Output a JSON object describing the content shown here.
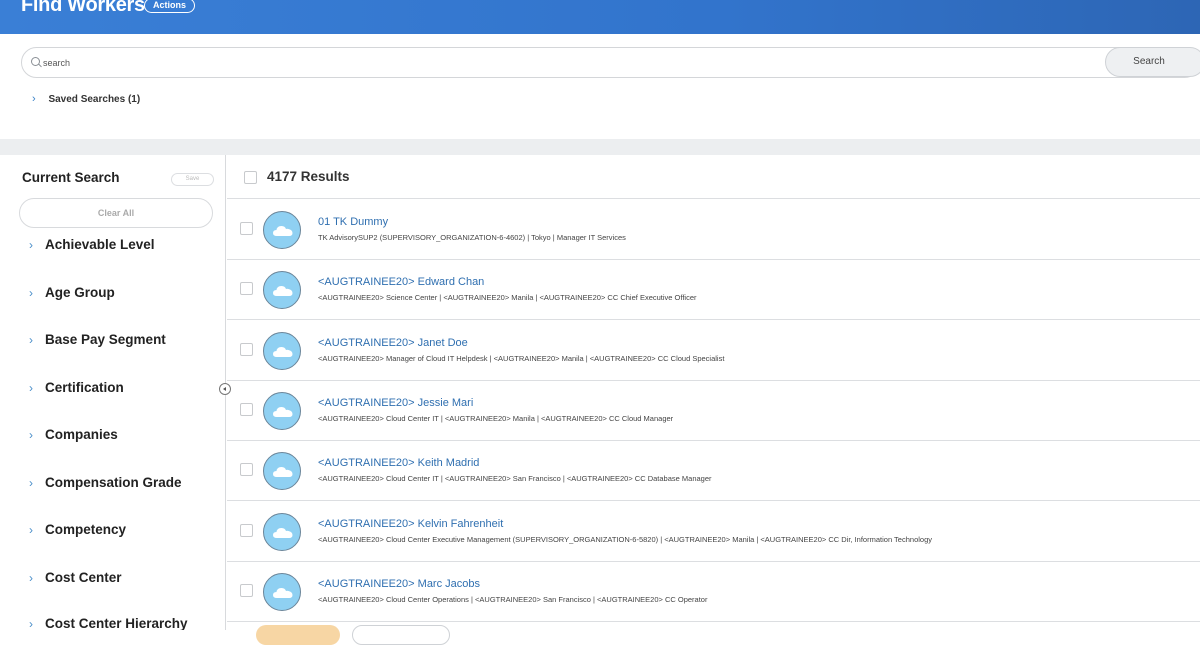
{
  "header": {
    "title": "Find Workers",
    "actions_label": "Actions",
    "bg_color": "#3274cc"
  },
  "search": {
    "placeholder": "search",
    "value": "",
    "button_label": "Search",
    "saved_searches_label": "Saved Searches (1)"
  },
  "sidebar": {
    "title": "Current Search",
    "save_label": "Save",
    "clear_all_label": "Clear All",
    "facets": [
      {
        "label": "Achievable Level"
      },
      {
        "label": "Age Group"
      },
      {
        "label": "Base Pay Segment"
      },
      {
        "label": "Certification"
      },
      {
        "label": "Companies"
      },
      {
        "label": "Compensation Grade"
      },
      {
        "label": "Competency"
      },
      {
        "label": "Cost Center"
      },
      {
        "label": "Cost Center Hierarchy"
      }
    ]
  },
  "results": {
    "count_label": "4177 Results",
    "items": [
      {
        "name": "01 TK Dummy",
        "detail": "TK AdvisorySUP2 (SUPERVISORY_ORGANIZATION-6-4602) | Tokyo | Manager IT Services"
      },
      {
        "name": "<AUGTRAINEE20> Edward Chan",
        "detail": "<AUGTRAINEE20> Science Center | <AUGTRAINEE20> Manila | <AUGTRAINEE20> CC Chief Executive Officer"
      },
      {
        "name": "<AUGTRAINEE20> Janet Doe",
        "detail": "<AUGTRAINEE20> Manager of Cloud IT Helpdesk | <AUGTRAINEE20> Manila | <AUGTRAINEE20> CC Cloud Specialist"
      },
      {
        "name": "<AUGTRAINEE20> Jessie Mari",
        "detail": "<AUGTRAINEE20> Cloud Center IT | <AUGTRAINEE20> Manila | <AUGTRAINEE20> CC Cloud Manager"
      },
      {
        "name": "<AUGTRAINEE20> Keith Madrid",
        "detail": "<AUGTRAINEE20> Cloud Center IT | <AUGTRAINEE20> San Francisco | <AUGTRAINEE20> CC Database Manager"
      },
      {
        "name": "<AUGTRAINEE20> Kelvin Fahrenheit",
        "detail": "<AUGTRAINEE20> Cloud Center Executive Management (SUPERVISORY_ORGANIZATION-6-5820) | <AUGTRAINEE20> Manila | <AUGTRAINEE20> CC Dir, Information Technology"
      },
      {
        "name": "<AUGTRAINEE20> Marc Jacobs",
        "detail": "<AUGTRAINEE20> Cloud Center Operations | <AUGTRAINEE20> San Francisco | <AUGTRAINEE20> CC Operator"
      }
    ]
  }
}
